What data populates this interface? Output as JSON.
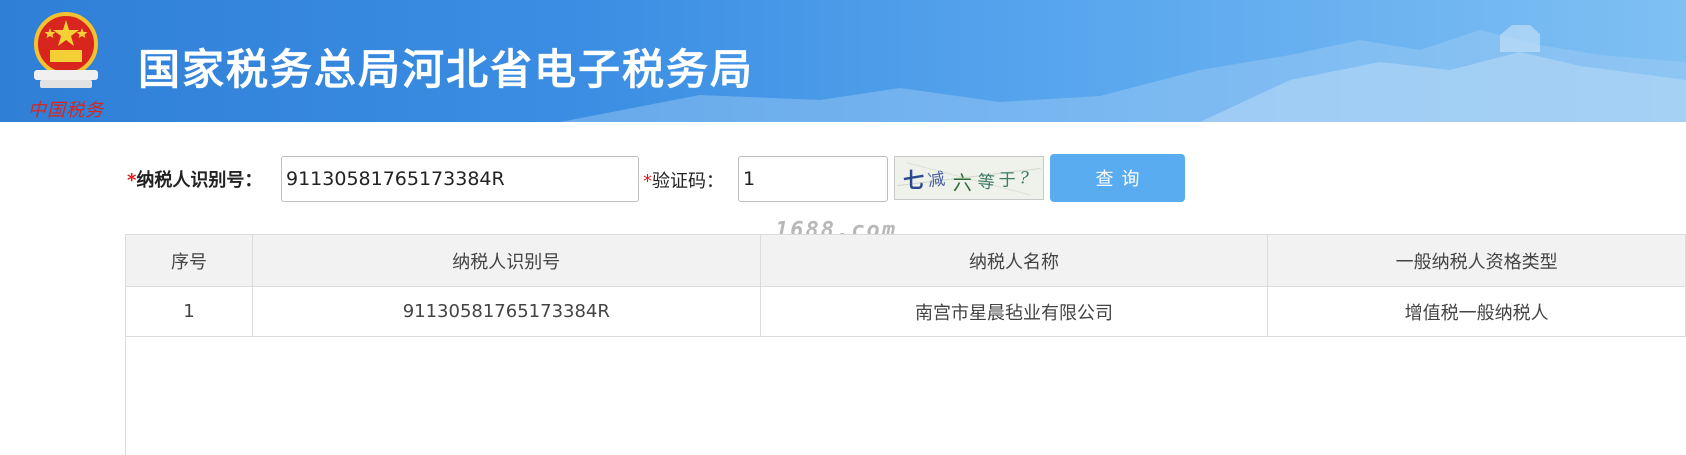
{
  "header": {
    "title": "国家税务总局河北省电子税务局",
    "seal_text": "中国税务",
    "emblem_icon": "national-emblem-icon",
    "colors": {
      "banner_start": "#2f7fd6",
      "banner_end": "#7fc0f3"
    }
  },
  "search": {
    "tin_required_mark": "*",
    "tin_label": "纳税人识别号：",
    "tin_value": "91130581765173384R",
    "code_required_mark": "*",
    "code_label": "验证码：",
    "code_value": "1",
    "captcha_text": "七减六等于?",
    "query_button": "查询",
    "button_color": "#5aacf0"
  },
  "watermark": "1688.com",
  "table": {
    "headers": [
      "序号",
      "纳税人识别号",
      "纳税人名称",
      "一般纳税人资格类型"
    ],
    "rows": [
      [
        "1",
        "91130581765173384R",
        "南宫市星晨毡业有限公司",
        "增值税一般纳税人"
      ]
    ]
  }
}
